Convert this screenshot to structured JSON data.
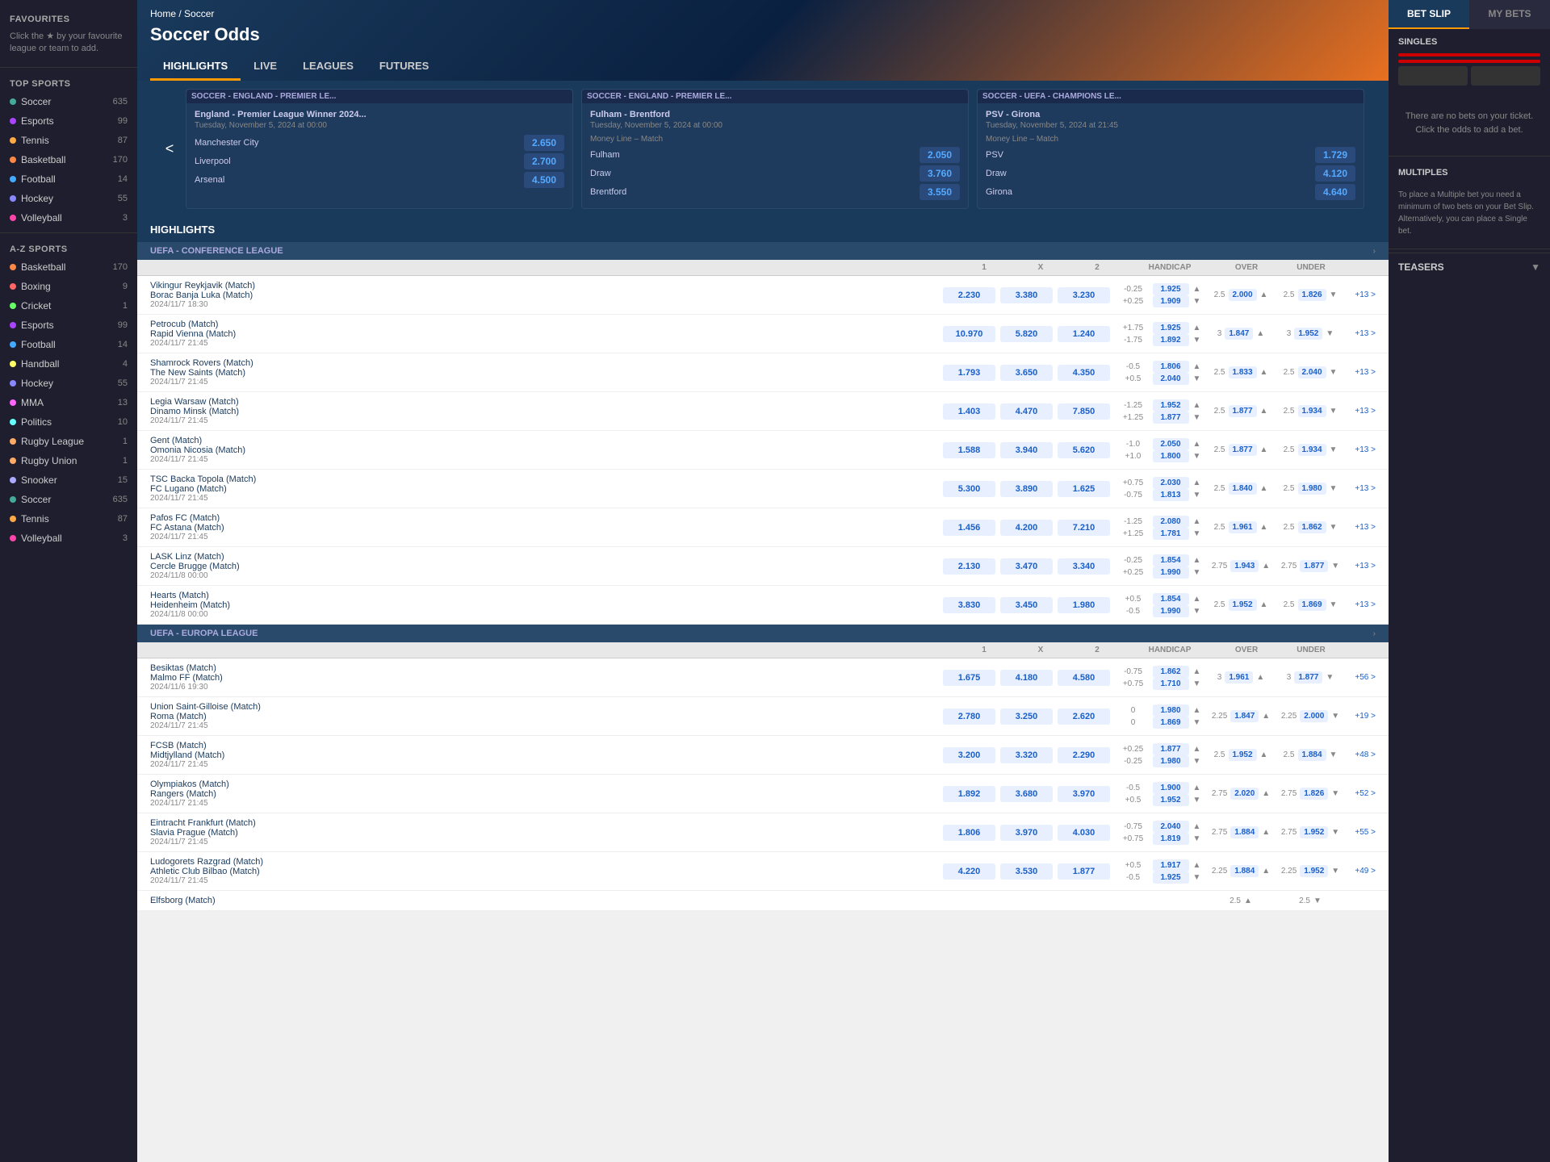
{
  "sidebar": {
    "favourites_title": "FAVOURITES",
    "favourites_text": "Click the ★ by your favourite league or team to add.",
    "top_sports_title": "TOP SPORTS",
    "top_sports": [
      {
        "name": "Soccer",
        "count": "635",
        "dot": "soccer"
      },
      {
        "name": "Esports",
        "count": "99",
        "dot": "esports"
      },
      {
        "name": "Tennis",
        "count": "87",
        "dot": "tennis"
      },
      {
        "name": "Basketball",
        "count": "170",
        "dot": "basketball"
      },
      {
        "name": "Football",
        "count": "14",
        "dot": "football"
      },
      {
        "name": "Hockey",
        "count": "55",
        "dot": "hockey"
      },
      {
        "name": "Volleyball",
        "count": "3",
        "dot": "volleyball"
      }
    ],
    "az_sports_title": "A-Z SPORTS",
    "az_sports": [
      {
        "name": "Basketball",
        "count": "170",
        "dot": "basketball"
      },
      {
        "name": "Boxing",
        "count": "9",
        "dot": "boxing"
      },
      {
        "name": "Cricket",
        "count": "1",
        "dot": "cricket"
      },
      {
        "name": "Esports",
        "count": "99",
        "dot": "esports"
      },
      {
        "name": "Football",
        "count": "14",
        "dot": "football"
      },
      {
        "name": "Handball",
        "count": "4",
        "dot": "handball"
      },
      {
        "name": "Hockey",
        "count": "55",
        "dot": "hockey"
      },
      {
        "name": "MMA",
        "count": "13",
        "dot": "mma"
      },
      {
        "name": "Politics",
        "count": "10",
        "dot": "politics"
      },
      {
        "name": "Rugby League",
        "count": "1",
        "dot": "rugby"
      },
      {
        "name": "Rugby Union",
        "count": "1",
        "dot": "rugby"
      },
      {
        "name": "Snooker",
        "count": "15",
        "dot": "snooker"
      },
      {
        "name": "Soccer",
        "count": "635",
        "dot": "soccer"
      },
      {
        "name": "Tennis",
        "count": "87",
        "dot": "tennis"
      },
      {
        "name": "Volleyball",
        "count": "3",
        "dot": "volleyball"
      }
    ]
  },
  "banner": {
    "breadcrumb_home": "Home",
    "breadcrumb_sep": " / ",
    "breadcrumb_current": "Soccer",
    "title": "Soccer Odds",
    "tabs": [
      "HIGHLIGHTS",
      "LIVE",
      "LEAGUES",
      "FUTURES"
    ]
  },
  "featured": [
    {
      "league": "SOCCER - ENGLAND - PREMIER LE...",
      "match": "England - Premier League Winner 2024...",
      "date": "Tuesday, November 5, 2024 at 00:00",
      "type": "",
      "odds": [
        {
          "label": "Manchester City",
          "value": "2.650"
        },
        {
          "label": "Liverpool",
          "value": "2.700"
        },
        {
          "label": "Arsenal",
          "value": "4.500"
        }
      ]
    },
    {
      "league": "SOCCER - ENGLAND - PREMIER LE...",
      "match": "Fulham - Brentford",
      "date": "Tuesday, November 5, 2024 at 00:00",
      "type": "Money Line – Match",
      "odds": [
        {
          "label": "Fulham",
          "value": "2.050"
        },
        {
          "label": "Draw",
          "value": "3.760"
        },
        {
          "label": "Brentford",
          "value": "3.550"
        }
      ]
    },
    {
      "league": "SOCCER - UEFA - CHAMPIONS LE...",
      "match": "PSV - Girona",
      "date": "Tuesday, November 5, 2024 at 21:45",
      "type": "Money Line – Match",
      "odds": [
        {
          "label": "PSV",
          "value": "1.729"
        },
        {
          "label": "Draw",
          "value": "4.120"
        },
        {
          "label": "Girona",
          "value": "4.640"
        }
      ]
    }
  ],
  "highlights_title": "HIGHLIGHTS",
  "leagues": [
    {
      "name": "UEFA - CONFERENCE LEAGUE",
      "cols": {
        "one": "1",
        "x": "X",
        "two": "2",
        "hcap": "HANDICAP",
        "over": "OVER",
        "under": "UNDER"
      },
      "matches": [
        {
          "team1": "Vikingur Reykjavik (Match)",
          "team2": "Borac Banja Luka (Match)",
          "date": "2024/11/7 18:30",
          "odd1": "2.230",
          "oddX": "3.380",
          "odd2": "3.230",
          "hcap_neg": "-0.25",
          "hcap_pos": "+0.25",
          "hcap_odd1": "1.925",
          "hcap_odd2": "1.909",
          "ou_val": "2.5",
          "over_odd": "2.000",
          "under_odd": "1.826",
          "more": "+13 >"
        },
        {
          "team1": "Petrocub (Match)",
          "team2": "Rapid Vienna (Match)",
          "date": "2024/11/7 21:45",
          "odd1": "10.970",
          "oddX": "5.820",
          "odd2": "1.240",
          "hcap_neg": "+1.75",
          "hcap_pos": "-1.75",
          "hcap_odd1": "1.925",
          "hcap_odd2": "1.892",
          "ou_val": "3",
          "over_odd": "1.847",
          "under_odd": "1.952",
          "more": "+13 >"
        },
        {
          "team1": "Shamrock Rovers (Match)",
          "team2": "The New Saints (Match)",
          "date": "2024/11/7 21:45",
          "odd1": "1.793",
          "oddX": "3.650",
          "odd2": "4.350",
          "hcap_neg": "-0.5",
          "hcap_pos": "+0.5",
          "hcap_odd1": "1.806",
          "hcap_odd2": "2.040",
          "ou_val": "2.5",
          "over_odd": "1.833",
          "under_odd": "2.040",
          "more": "+13 >"
        },
        {
          "team1": "Legia Warsaw (Match)",
          "team2": "Dinamo Minsk (Match)",
          "date": "2024/11/7 21:45",
          "odd1": "1.403",
          "oddX": "4.470",
          "odd2": "7.850",
          "hcap_neg": "-1.25",
          "hcap_pos": "+1.25",
          "hcap_odd1": "1.952",
          "hcap_odd2": "1.877",
          "ou_val": "2.5",
          "over_odd": "1.877",
          "under_odd": "1.934",
          "more": "+13 >"
        },
        {
          "team1": "Gent (Match)",
          "team2": "Omonia Nicosia (Match)",
          "date": "2024/11/7 21:45",
          "odd1": "1.588",
          "oddX": "3.940",
          "odd2": "5.620",
          "hcap_neg": "-1.0",
          "hcap_pos": "+1.0",
          "hcap_odd1": "2.050",
          "hcap_odd2": "1.800",
          "ou_val": "2.5",
          "over_odd": "1.877",
          "under_odd": "1.934",
          "more": "+13 >"
        },
        {
          "team1": "TSC Backa Topola (Match)",
          "team2": "FC Lugano (Match)",
          "date": "2024/11/7 21:45",
          "odd1": "5.300",
          "oddX": "3.890",
          "odd2": "1.625",
          "hcap_neg": "+0.75",
          "hcap_pos": "-0.75",
          "hcap_odd1": "2.030",
          "hcap_odd2": "1.813",
          "ou_val": "2.5",
          "over_odd": "1.840",
          "under_odd": "1.980",
          "more": "+13 >"
        },
        {
          "team1": "Pafos FC (Match)",
          "team2": "FC Astana (Match)",
          "date": "2024/11/7 21:45",
          "odd1": "1.456",
          "oddX": "4.200",
          "odd2": "7.210",
          "hcap_neg": "-1.25",
          "hcap_pos": "+1.25",
          "hcap_odd1": "2.080",
          "hcap_odd2": "1.781",
          "ou_val": "2.5",
          "over_odd": "1.961",
          "under_odd": "1.862",
          "more": "+13 >"
        },
        {
          "team1": "LASK Linz (Match)",
          "team2": "Cercle Brugge (Match)",
          "date": "2024/11/8 00:00",
          "odd1": "2.130",
          "oddX": "3.470",
          "odd2": "3.340",
          "hcap_neg": "-0.25",
          "hcap_pos": "+0.25",
          "hcap_odd1": "1.854",
          "hcap_odd2": "1.990",
          "ou_val": "2.75",
          "over_odd": "1.943",
          "under_odd": "1.877",
          "more": "+13 >"
        },
        {
          "team1": "Hearts (Match)",
          "team2": "Heidenheim (Match)",
          "date": "2024/11/8 00:00",
          "odd1": "3.830",
          "oddX": "3.450",
          "odd2": "1.980",
          "hcap_neg": "+0.5",
          "hcap_pos": "-0.5",
          "hcap_odd1": "1.854",
          "hcap_odd2": "1.990",
          "ou_val": "2.5",
          "over_odd": "1.952",
          "under_odd": "1.869",
          "more": "+13 >"
        }
      ]
    },
    {
      "name": "UEFA - EUROPA LEAGUE",
      "cols": {
        "one": "1",
        "x": "X",
        "two": "2",
        "hcap": "HANDICAP",
        "over": "OVER",
        "under": "UNDER"
      },
      "matches": [
        {
          "team1": "Besiktas (Match)",
          "team2": "Malmo FF (Match)",
          "date": "2024/11/6 19:30",
          "odd1": "1.675",
          "oddX": "4.180",
          "odd2": "4.580",
          "hcap_neg": "-0.75",
          "hcap_pos": "+0.75",
          "hcap_odd1": "1.862",
          "hcap_odd2": "1.710",
          "ou_val": "3",
          "over_odd": "1.961",
          "under_odd": "1.877",
          "more": "+56 >"
        },
        {
          "team1": "Union Saint-Gilloise (Match)",
          "team2": "Roma (Match)",
          "date": "2024/11/7 21:45",
          "odd1": "2.780",
          "oddX": "3.250",
          "odd2": "2.620",
          "hcap_neg": "0",
          "hcap_pos": "0",
          "hcap_odd1": "1.980",
          "hcap_odd2": "1.869",
          "ou_val": "2.25",
          "over_odd": "1.847",
          "under_odd": "2.000",
          "more": "+19 >"
        },
        {
          "team1": "FCSB (Match)",
          "team2": "Midtjylland (Match)",
          "date": "2024/11/7 21:45",
          "odd1": "3.200",
          "oddX": "3.320",
          "odd2": "2.290",
          "hcap_neg": "+0.25",
          "hcap_pos": "-0.25",
          "hcap_odd1": "1.877",
          "hcap_odd2": "1.980",
          "ou_val": "2.5",
          "over_odd": "1.952",
          "under_odd": "1.884",
          "more": "+48 >"
        },
        {
          "team1": "Olympiakos (Match)",
          "team2": "Rangers (Match)",
          "date": "2024/11/7 21:45",
          "odd1": "1.892",
          "oddX": "3.680",
          "odd2": "3.970",
          "hcap_neg": "-0.5",
          "hcap_pos": "+0.5",
          "hcap_odd1": "1.900",
          "hcap_odd2": "1.952",
          "ou_val": "2.75",
          "over_odd": "2.020",
          "under_odd": "1.826",
          "more": "+52 >"
        },
        {
          "team1": "Eintracht Frankfurt (Match)",
          "team2": "Slavia Prague (Match)",
          "date": "2024/11/7 21:45",
          "odd1": "1.806",
          "oddX": "3.970",
          "odd2": "4.030",
          "hcap_neg": "-0.75",
          "hcap_pos": "+0.75",
          "hcap_odd1": "2.040",
          "hcap_odd2": "1.819",
          "ou_val": "2.75",
          "over_odd": "1.884",
          "under_odd": "1.952",
          "more": "+55 >"
        },
        {
          "team1": "Ludogorets Razgrad (Match)",
          "team2": "Athletic Club Bilbao (Match)",
          "date": "2024/11/7 21:45",
          "odd1": "4.220",
          "oddX": "3.530",
          "odd2": "1.877",
          "hcap_neg": "+0.5",
          "hcap_pos": "-0.5",
          "hcap_odd1": "1.917",
          "hcap_odd2": "1.925",
          "ou_val": "2.25",
          "over_odd": "1.884",
          "under_odd": "1.952",
          "more": "+49 >"
        },
        {
          "team1": "Elfsborg (Match)",
          "team2": "",
          "date": "",
          "odd1": "",
          "oddX": "",
          "odd2": "",
          "hcap_neg": "",
          "hcap_pos": "",
          "hcap_odd1": "",
          "hcap_odd2": "",
          "ou_val": "2.5",
          "over_odd": "",
          "under_odd": "",
          "more": ""
        }
      ]
    }
  ],
  "betslip": {
    "tab1": "BET SLIP",
    "tab2": "MY BETS",
    "singles_title": "SINGLES",
    "empty_text": "There are no bets on your ticket. Click the odds to add a bet.",
    "multiples_title": "MULTIPLES",
    "multiples_text": "To place a Multiple bet you need a minimum of two bets on your Bet Slip. Alternatively, you can place a Single bet.",
    "teasers_label": "TEASERS"
  }
}
